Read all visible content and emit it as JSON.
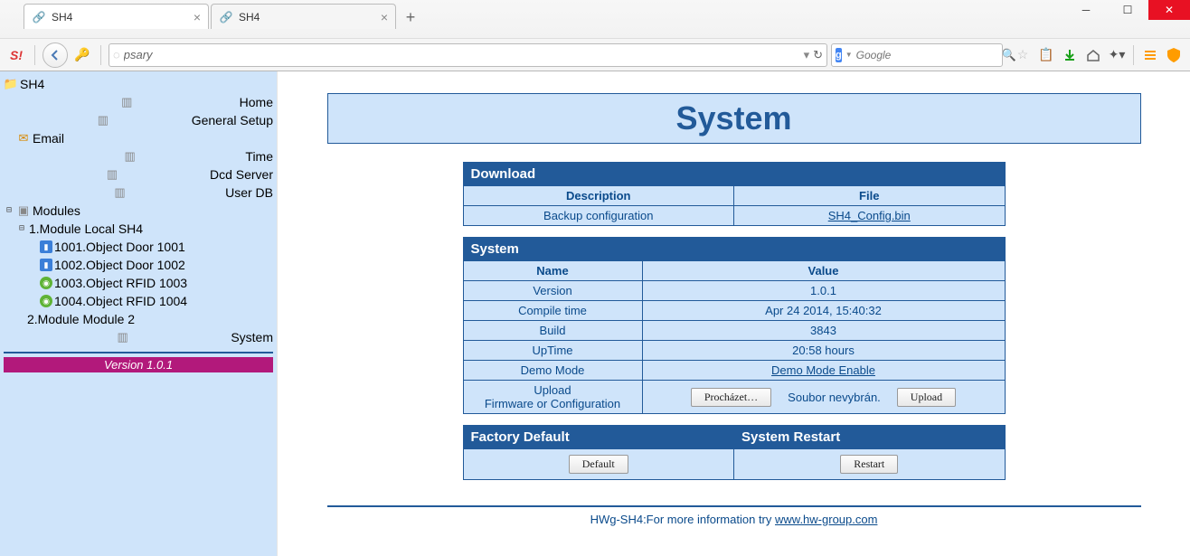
{
  "browser": {
    "tabs": [
      {
        "title": "SH4",
        "active": true
      },
      {
        "title": "SH4",
        "active": false
      }
    ],
    "url": "psary",
    "search_placeholder": "Google"
  },
  "sidebar": {
    "root": "SH4",
    "items": [
      "Home",
      "General Setup",
      "Email",
      "Time",
      "Dcd Server",
      "User DB"
    ],
    "modules_label": "Modules",
    "module1": {
      "label": "1.Module Local SH4",
      "children": [
        "1001.Object Door 1001",
        "1002.Object Door 1002",
        "1003.Object RFID 1003",
        "1004.Object RFID 1004"
      ]
    },
    "module2": "2.Module Module 2",
    "system_label": "System",
    "version_bar": "Version 1.0.1"
  },
  "page_title": "System",
  "download": {
    "section": "Download",
    "col_desc": "Description",
    "col_file": "File",
    "row_desc": "Backup configuration",
    "row_file": "SH4_Config.bin"
  },
  "system": {
    "section": "System",
    "col_name": "Name",
    "col_value": "Value",
    "rows": [
      {
        "name": "Version",
        "value": "1.0.1"
      },
      {
        "name": "Compile time",
        "value": "Apr 24 2014, 15:40:32"
      },
      {
        "name": "Build",
        "value": "3843"
      },
      {
        "name": "UpTime",
        "value": "20:58 hours"
      }
    ],
    "demo_name": "Demo Mode",
    "demo_link": "Demo Mode Enable",
    "upload_name_l1": "Upload",
    "upload_name_l2": "Firmware or Configuration",
    "browse_btn": "Procházet…",
    "file_status": "Soubor nevybrán.",
    "upload_btn": "Upload"
  },
  "actions": {
    "factory_header": "Factory Default",
    "restart_header": "System Restart",
    "default_btn": "Default",
    "restart_btn": "Restart"
  },
  "footer": {
    "text": "HWg-SH4:For more information try ",
    "link": "www.hw-group.com"
  }
}
